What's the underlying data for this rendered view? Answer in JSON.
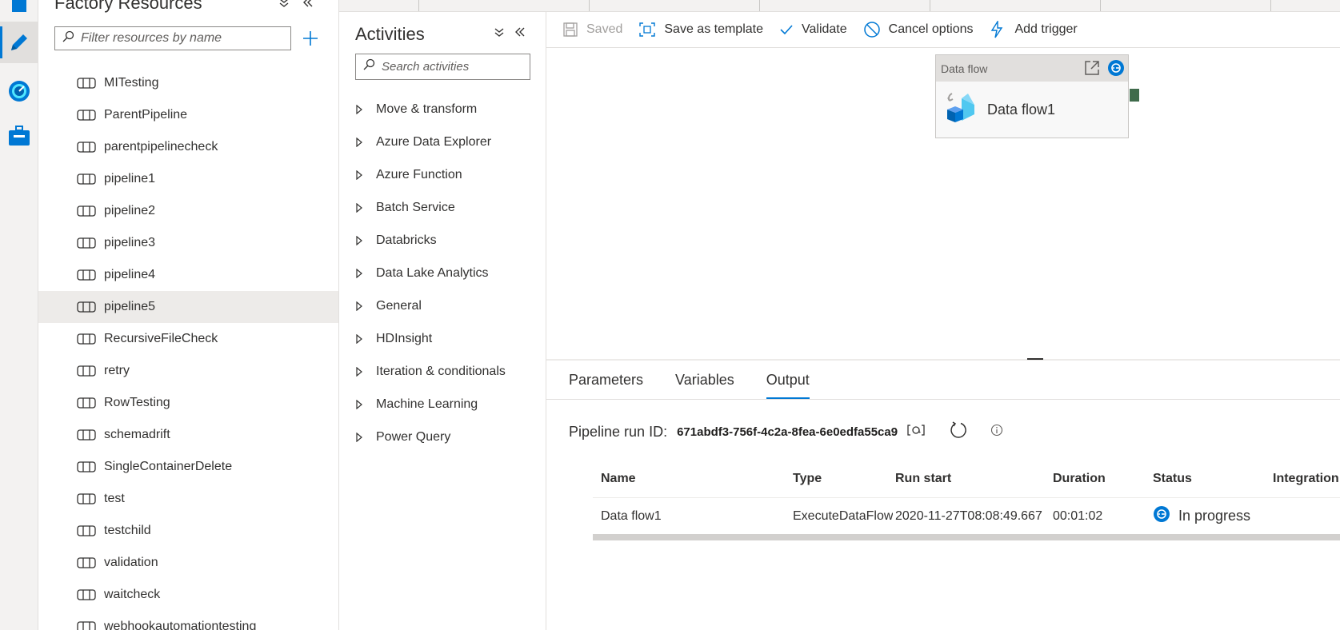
{
  "resources": {
    "title": "Factory Resources",
    "filter_placeholder": "Filter resources by name",
    "items": [
      {
        "label": "MITesting"
      },
      {
        "label": "ParentPipeline"
      },
      {
        "label": "parentpipelinecheck"
      },
      {
        "label": "pipeline1"
      },
      {
        "label": "pipeline2"
      },
      {
        "label": "pipeline3"
      },
      {
        "label": "pipeline4"
      },
      {
        "label": "pipeline5",
        "selected": true
      },
      {
        "label": "RecursiveFileCheck"
      },
      {
        "label": "retry"
      },
      {
        "label": "RowTesting"
      },
      {
        "label": "schemadrift"
      },
      {
        "label": "SingleContainerDelete"
      },
      {
        "label": "test"
      },
      {
        "label": "testchild"
      },
      {
        "label": "validation"
      },
      {
        "label": "waitcheck"
      },
      {
        "label": "webhookautomationtesting"
      }
    ]
  },
  "activities": {
    "title": "Activities",
    "search_placeholder": "Search activities",
    "categories": [
      "Move & transform",
      "Azure Data Explorer",
      "Azure Function",
      "Batch Service",
      "Databricks",
      "Data Lake Analytics",
      "General",
      "HDInsight",
      "Iteration & conditionals",
      "Machine Learning",
      "Power Query"
    ]
  },
  "toolbar": {
    "saved": "Saved",
    "save_as_template": "Save as template",
    "validate": "Validate",
    "cancel_options": "Cancel options",
    "add_trigger": "Add trigger"
  },
  "canvas": {
    "node_type": "Data flow",
    "node_name": "Data flow1"
  },
  "bottom": {
    "tabs": [
      "Parameters",
      "Variables",
      "Output"
    ],
    "active_tab": "Output",
    "run_label": "Pipeline run ID:",
    "run_id": "671abdf3-756f-4c2a-8fea-6e0edfa55ca9",
    "columns": [
      "Name",
      "Type",
      "Run start",
      "Duration",
      "Status",
      "Integration"
    ],
    "rows": [
      {
        "name": "Data flow1",
        "type": "ExecuteDataFlow",
        "run_start": "2020-11-27T08:08:49.667",
        "duration": "00:01:02",
        "status": "In progress"
      }
    ]
  },
  "colors": {
    "accent": "#0078d4",
    "port": "#3f6b4b"
  }
}
